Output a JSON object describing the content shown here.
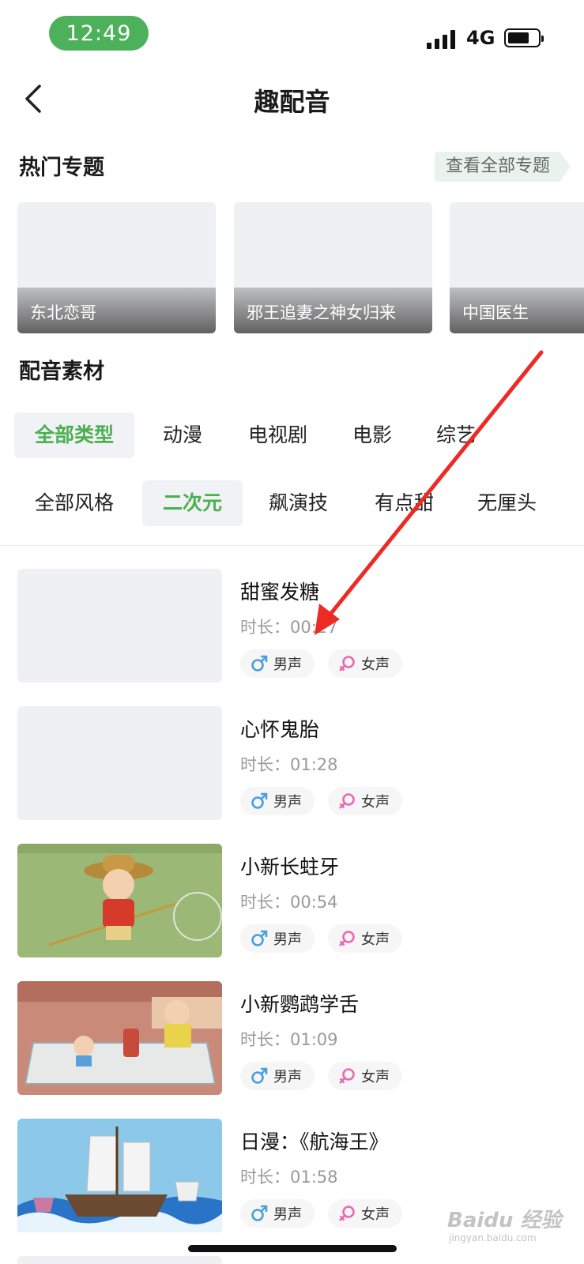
{
  "status_bar": {
    "time": "12:49",
    "network": "4G",
    "signal": "signal-bars-icon",
    "battery": "battery-icon"
  },
  "nav": {
    "back_icon": "chevron-left-icon",
    "title": "趣配音"
  },
  "hot_topics": {
    "title": "热门专题",
    "view_all": "查看全部专题",
    "items": [
      {
        "label": "东北恋哥"
      },
      {
        "label": "邪王追妻之神女归来"
      },
      {
        "label": "中国医生"
      }
    ]
  },
  "materials": {
    "title": "配音素材",
    "type_filters": [
      {
        "label": "全部类型",
        "active": true
      },
      {
        "label": "动漫",
        "active": false
      },
      {
        "label": "电视剧",
        "active": false
      },
      {
        "label": "电影",
        "active": false
      },
      {
        "label": "综艺",
        "active": false
      }
    ],
    "style_filters": [
      {
        "label": "全部风格",
        "active": false
      },
      {
        "label": "二次元",
        "active": true
      },
      {
        "label": "飙演技",
        "active": false
      },
      {
        "label": "有点甜",
        "active": false
      },
      {
        "label": "无厘头",
        "active": false
      }
    ],
    "male_label": "男声",
    "female_label": "女声",
    "male_icon": "male-symbol-icon",
    "female_icon": "female-symbol-icon",
    "items": [
      {
        "title": "甜蜜发糖",
        "duration": "时长：00:27"
      },
      {
        "title": "心怀鬼胎",
        "duration": "时长：01:28"
      },
      {
        "title": "小新长蛀牙",
        "duration": "时长：00:54"
      },
      {
        "title": "小新鹦鹉学舌",
        "duration": "时长：01:09"
      },
      {
        "title": "日漫：《航海王》",
        "duration": "时长：01:58"
      }
    ]
  },
  "colors": {
    "accent": "#4caf50",
    "male": "#4a9fe0",
    "female": "#e86ab5",
    "annotation_arrow": "#ee2a24"
  },
  "watermark": {
    "main": "Baidu 经验",
    "sub": "jingyan.baidu.com"
  }
}
